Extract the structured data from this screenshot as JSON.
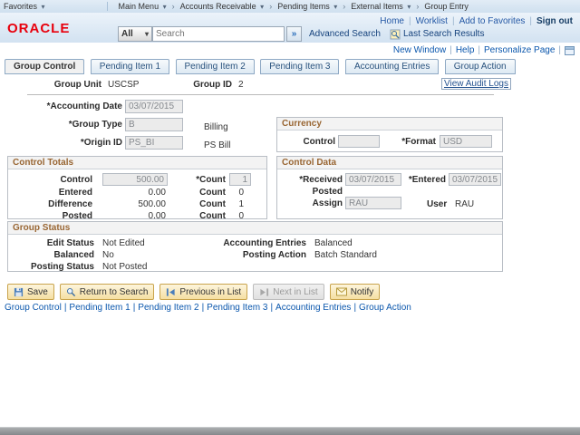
{
  "colors": {
    "oracle_red": "#e8000d",
    "link_blue": "#1b57a5",
    "groupbox_title_brown": "#996633",
    "button_tan": "#f5dfa2"
  },
  "icons": {
    "dropdown_arrow": "▾",
    "crumb_separator": "›",
    "search_go": "»",
    "pipe": "|"
  },
  "breadcrumb": {
    "favorites": "Favorites",
    "main_menu": "Main Menu",
    "path": [
      "Accounts Receivable",
      "Pending Items",
      "External Items",
      "Group Entry"
    ]
  },
  "header": {
    "logo_text": "ORACLE",
    "nav": {
      "home": "Home",
      "worklist": "Worklist",
      "add_to_favorites": "Add to Favorites",
      "sign_out": "Sign out"
    },
    "search": {
      "scope": "All",
      "placeholder": "Search",
      "advanced_label": "Advanced Search",
      "last_results_label": "Last Search Results"
    }
  },
  "pagebar": {
    "new_window": "New Window",
    "help": "Help",
    "personalize_page": "Personalize Page"
  },
  "tabs": [
    {
      "label": "Group Control",
      "active": true
    },
    {
      "label": "Pending Item 1",
      "active": false
    },
    {
      "label": "Pending Item 2",
      "active": false
    },
    {
      "label": "Pending Item 3",
      "active": false
    },
    {
      "label": "Accounting Entries",
      "active": false
    },
    {
      "label": "Group Action",
      "active": false
    }
  ],
  "group_header": {
    "group_unit_label": "Group Unit",
    "group_unit_value": "USCSP",
    "group_id_label": "Group ID",
    "group_id_value": "2",
    "view_audit_logs_label": "View Audit Logs"
  },
  "fields": {
    "accounting_date_label": "*Accounting Date",
    "accounting_date_value": "03/07/2015",
    "group_type_label": "*Group Type",
    "group_type_value": "B",
    "group_type_desc": "Billing",
    "origin_id_label": "*Origin ID",
    "origin_id_value": "PS_BI",
    "origin_id_desc": "PS Bill"
  },
  "currency": {
    "title": "Currency",
    "control_label": "Control",
    "control_value": "",
    "format_label": "*Format",
    "format_value": "USD"
  },
  "control_totals": {
    "title": "Control Totals",
    "rows": [
      {
        "label": "Control",
        "amount": "500.00",
        "count_label": "*Count",
        "count": "1"
      },
      {
        "label": "Entered",
        "amount": "0.00",
        "count_label": "Count",
        "count": "0"
      },
      {
        "label": "Difference",
        "amount": "500.00",
        "count_label": "Count",
        "count": "1"
      },
      {
        "label": "Posted",
        "amount": "0.00",
        "count_label": "Count",
        "count": "0"
      }
    ]
  },
  "control_data": {
    "title": "Control Data",
    "received_label": "*Received",
    "received_value": "03/07/2015",
    "entered_label": "*Entered",
    "entered_value": "03/07/2015",
    "posted_label": "Posted",
    "assign_label": "Assign",
    "assign_value": "RAU",
    "user_label": "User",
    "user_value": "RAU"
  },
  "group_status": {
    "title": "Group Status",
    "edit_status_label": "Edit Status",
    "edit_status_value": "Not Edited",
    "balanced_label": "Balanced",
    "balanced_value": "No",
    "posting_status_label": "Posting Status",
    "posting_status_value": "Not Posted",
    "accounting_entries_label": "Accounting Entries",
    "accounting_entries_value": "Balanced",
    "posting_action_label": "Posting Action",
    "posting_action_value": "Batch Standard"
  },
  "toolbar": {
    "save": "Save",
    "return_to_search": "Return to Search",
    "previous_in_list": "Previous in List",
    "next_in_list": "Next in List",
    "notify": "Notify"
  },
  "footer_links": [
    "Group Control",
    "Pending Item 1",
    "Pending Item 2",
    "Pending Item 3",
    "Accounting Entries",
    "Group Action"
  ]
}
